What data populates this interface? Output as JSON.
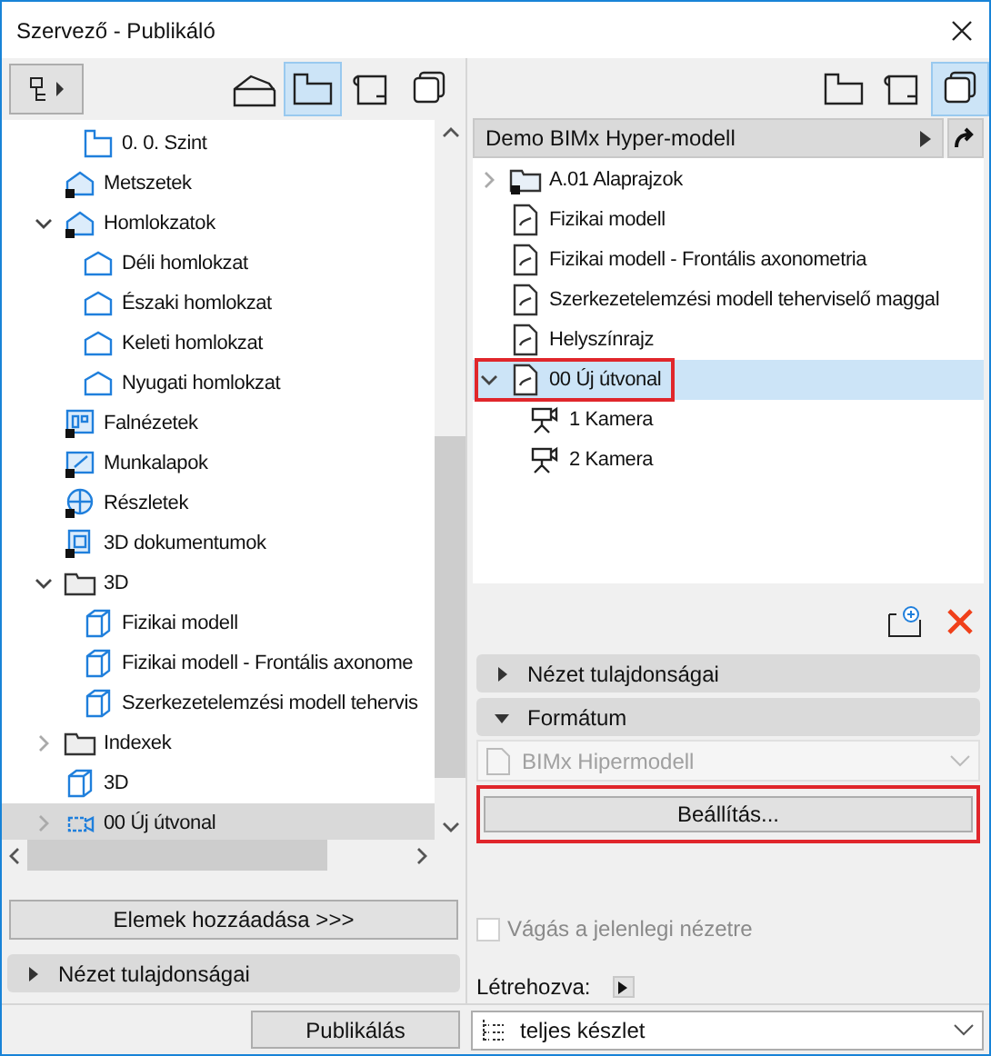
{
  "window": {
    "title": "Szervező - Publikáló"
  },
  "left": {
    "view_buttons": [
      {
        "kind": "model3d",
        "selected": false
      },
      {
        "kind": "plan",
        "selected": true
      },
      {
        "kind": "layout",
        "selected": false
      },
      {
        "kind": "sets",
        "selected": false
      }
    ],
    "tree": [
      {
        "children": [
          {
            "label": "0. 0. Szint",
            "kind": "plan",
            "selected": false
          }
        ]
      },
      {
        "label": "Metszetek",
        "kind": "section",
        "selected": false
      },
      {
        "label": "Homlokzatok",
        "kind": "section",
        "selected": false,
        "expanded": true,
        "children": [
          {
            "label": "Déli homlokzat",
            "kind": "elevation",
            "selected": false
          },
          {
            "label": "Északi homlokzat",
            "kind": "elevation",
            "selected": false
          },
          {
            "label": "Keleti homlokzat",
            "kind": "elevation",
            "selected": false
          },
          {
            "label": "Nyugati homlokzat",
            "kind": "elevation",
            "selected": false
          }
        ]
      },
      {
        "label": "Falnézetek",
        "kind": "wall",
        "selected": false
      },
      {
        "label": "Munkalapok",
        "kind": "worksheet",
        "selected": false
      },
      {
        "label": "Részletek",
        "kind": "detail",
        "selected": false
      },
      {
        "label": "3D dokumentumok",
        "kind": "doc3d",
        "selected": false
      },
      {
        "label": "3D",
        "kind": "folder",
        "selected": false,
        "expanded": true,
        "children": [
          {
            "label": "Fizikai modell",
            "kind": "cube",
            "selected": false
          },
          {
            "label": "Fizikai modell - Frontális axonome",
            "kind": "cube",
            "selected": false
          },
          {
            "label": "Szerkezetelemzési modell tehervis",
            "kind": "cube",
            "selected": false
          }
        ]
      },
      {
        "label": "Indexek",
        "kind": "folder",
        "selected": false,
        "expanded": false
      },
      {
        "label": "3D",
        "kind": "cube",
        "selected": false
      },
      {
        "label": "00 Új útvonal",
        "kind": "path",
        "selected": true,
        "expanded": false
      }
    ],
    "add_button": "Elemek hozzáadása >>>",
    "properties_section": {
      "label": "Nézet tulajdonságai",
      "expanded": false
    }
  },
  "right": {
    "view_buttons": [
      {
        "kind": "plan",
        "selected": false
      },
      {
        "kind": "layout",
        "selected": false
      },
      {
        "kind": "sets",
        "selected": true
      }
    ],
    "path": "Demo BIMx Hyper-modell",
    "tree": [
      {
        "label": "A.01 Alaprajzok",
        "kind": "setfolder",
        "selected": false,
        "expanded": false
      },
      {
        "label": "Fizikai modell",
        "kind": "bimx",
        "selected": false
      },
      {
        "label": "Fizikai modell - Frontális axonometria",
        "kind": "bimx",
        "selected": false
      },
      {
        "label": "Szerkezetelemzési modell teherviselő maggal",
        "kind": "bimx",
        "selected": false
      },
      {
        "label": "Helyszínrajz",
        "kind": "bimx",
        "selected": false
      },
      {
        "label": "00 Új útvonal",
        "kind": "bimx",
        "selected": true,
        "highlighted": true,
        "expanded": true,
        "children": [
          {
            "label": "1 Kamera",
            "kind": "camera",
            "selected": false
          },
          {
            "label": "2 Kamera",
            "kind": "camera",
            "selected": false
          }
        ]
      }
    ],
    "sections": [
      {
        "label": "Nézet tulajdonságai",
        "expanded": false
      },
      {
        "label": "Formátum",
        "expanded": true
      }
    ],
    "format": {
      "value": "BIMx Hipermodell",
      "disabled": true
    },
    "settings_button": {
      "label": "Beállítás...",
      "highlighted": true
    },
    "crop_checkbox": {
      "label": "Vágás a jelenlegi nézetre",
      "checked": false,
      "disabled": true
    },
    "created_label": "Létrehozva:"
  },
  "footer": {
    "publish_button": "Publikálás",
    "set_select": "teljes készlet"
  }
}
